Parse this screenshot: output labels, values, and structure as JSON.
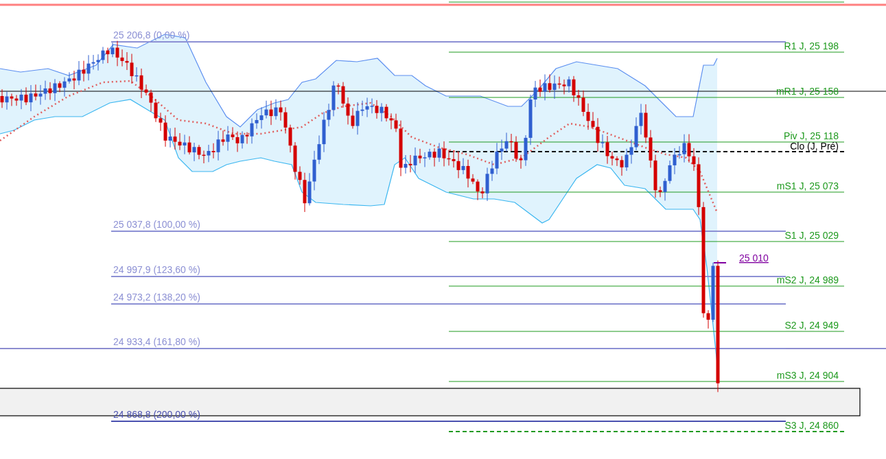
{
  "fibonacci_levels": [
    {
      "label": "25 206,8 (0,00 %)",
      "color": "#8c90d4"
    },
    {
      "label": "25 037,8 (100,00 %)",
      "color": "#8c90d4"
    },
    {
      "label": "24 997,9 (123,60 %)",
      "color": "#8c90d4"
    },
    {
      "label": "24 973,2 (138,20 %)",
      "color": "#8c90d4"
    },
    {
      "label": "24 933,4 (161,80 %)",
      "color": "#8c90d4"
    },
    {
      "label": "24 868,8 (200,00 %)",
      "color": "#4a50b0"
    }
  ],
  "pivot_levels": [
    {
      "label": "R1 J, 25 198",
      "kind": "solid",
      "color": "#1f9a1f"
    },
    {
      "label": "mR1 J, 25 158",
      "kind": "solid",
      "color": "#1f9a1f"
    },
    {
      "label": "Piv J, 25 118",
      "kind": "solid",
      "color": "#1f9a1f"
    },
    {
      "label": "Clo (J, Pré)",
      "kind": "dashed",
      "color": "#000000"
    },
    {
      "label": "mS1 J, 25 073",
      "kind": "solid",
      "color": "#1f9a1f"
    },
    {
      "label": "S1 J, 25 029",
      "kind": "solid",
      "color": "#1f9a1f"
    },
    {
      "label": "mS2 J, 24 989",
      "kind": "solid",
      "color": "#1f9a1f"
    },
    {
      "label": "S2 J, 24 949",
      "kind": "solid",
      "color": "#1f9a1f"
    },
    {
      "label": "mS3 J, 24 904",
      "kind": "solid",
      "color": "#1f9a1f"
    },
    {
      "label": "S3 J, 24 860",
      "kind": "dashed",
      "color": "#1f9a1f"
    }
  ],
  "price_marker": {
    "label": "25 010"
  }
}
